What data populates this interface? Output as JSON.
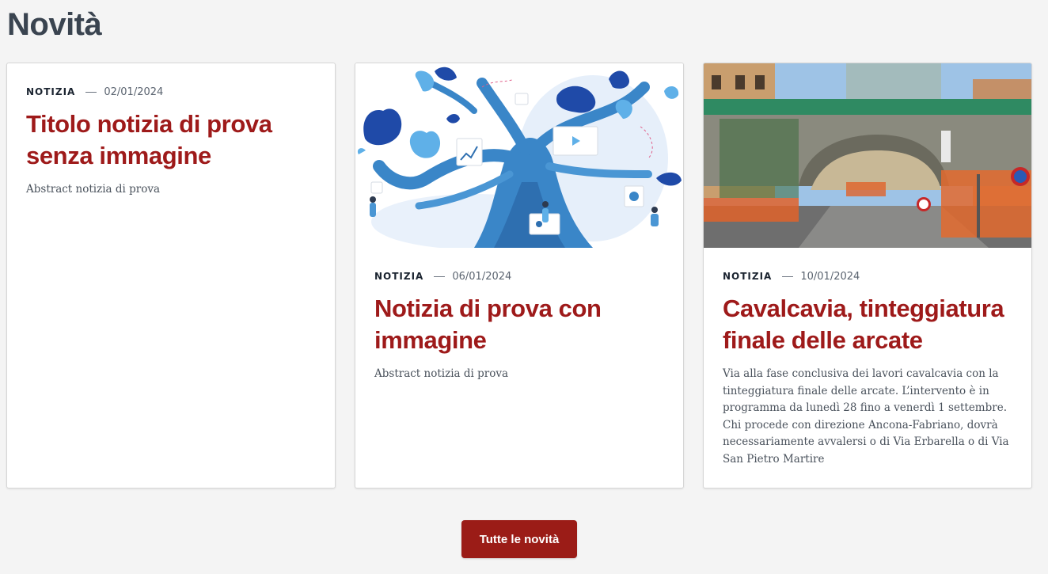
{
  "section": {
    "title": "Novità"
  },
  "cards": [
    {
      "category": "NOTIZIA",
      "date": "02/01/2024",
      "title": "Titolo notizia di prova senza immagine",
      "abstract": "Abstract notizia di prova",
      "has_image": false
    },
    {
      "category": "NOTIZIA",
      "date": "06/01/2024",
      "title": "Notizia di prova con immagine",
      "abstract": "Abstract notizia di prova",
      "has_image": true,
      "image": "tree-illustration"
    },
    {
      "category": "NOTIZIA",
      "date": "10/01/2024",
      "title": "Cavalcavia, tinteggiatura finale delle arcate",
      "abstract": "Via alla fase conclusiva dei lavori cavalcavia con la tinteggiatura finale delle arcate. L’intervento è in programma da lunedì 28 fino a venerdì 1 settembre. Chi procede con direzione Ancona-Fabriano, dovrà necessariamente avvalersi o di Via Erbarella o di Via San Pietro Martire",
      "has_image": true,
      "image": "overpass-photo"
    }
  ],
  "button": {
    "label": "Tutte le novità"
  },
  "colors": {
    "background": "#f4f4f4",
    "title_red": "#9e1a1a",
    "button_red": "#9b1c17",
    "heading_gray": "#3a4450"
  }
}
